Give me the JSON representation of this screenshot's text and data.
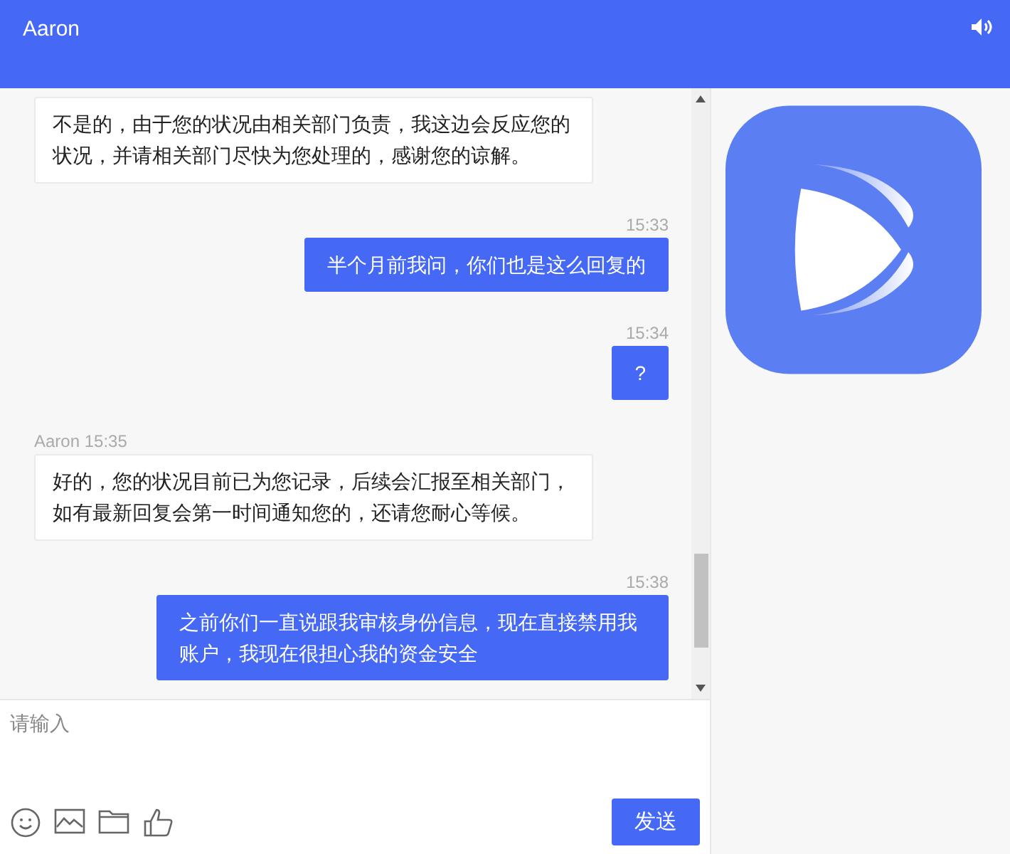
{
  "header": {
    "title": "Aaron"
  },
  "messages": [
    {
      "kind": "agent",
      "text": "不是的，由于您的状况由相关部门负责，我这边会反应您的状况，并请相关部门尽快为您处理的，感谢您的谅解。"
    },
    {
      "kind": "user",
      "meta": "15:33",
      "text": "半个月前我问，你们也是这么回复的"
    },
    {
      "kind": "user",
      "meta": "15:34",
      "text": "?"
    },
    {
      "kind": "agent",
      "meta": "Aaron 15:35",
      "text": "好的，您的状况目前已为您记录，后续会汇报至相关部门，如有最新回复会第一时间通知您的，还请您耐心等候。"
    },
    {
      "kind": "user",
      "meta": "15:38",
      "text": "之前你们一直说跟我审核身份信息，现在直接禁用我账户，我现在很担心我的资金安全"
    }
  ],
  "composer": {
    "placeholder": "请输入",
    "send": "发送"
  }
}
